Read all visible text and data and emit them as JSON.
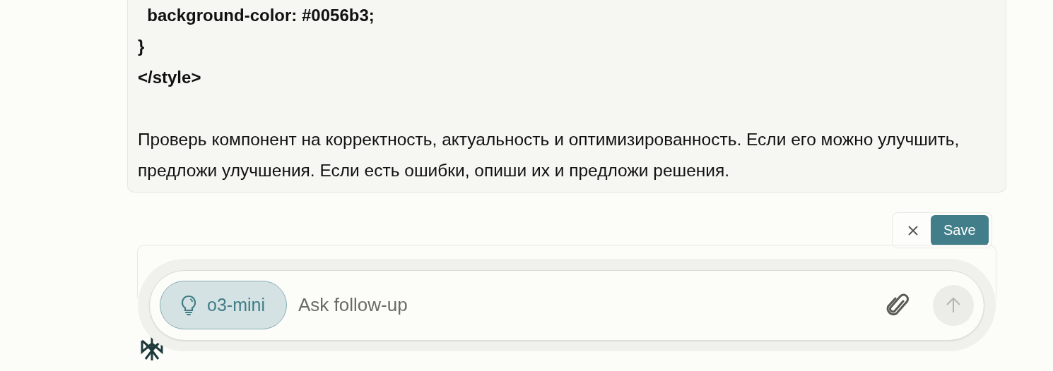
{
  "editor": {
    "code_lines": [
      "  background-color: #0056b3;",
      "}",
      "</style>"
    ],
    "message": "Проверь компонент на корректность, актуальность и оптимизированность. Если его можно улучшить, предложи улучшения. Если есть ошибки, опиши их и предложи решения."
  },
  "edit_actions": {
    "save": "Save"
  },
  "composer": {
    "model": "o3-mini",
    "placeholder": "Ask follow-up",
    "send_disabled": true
  }
}
